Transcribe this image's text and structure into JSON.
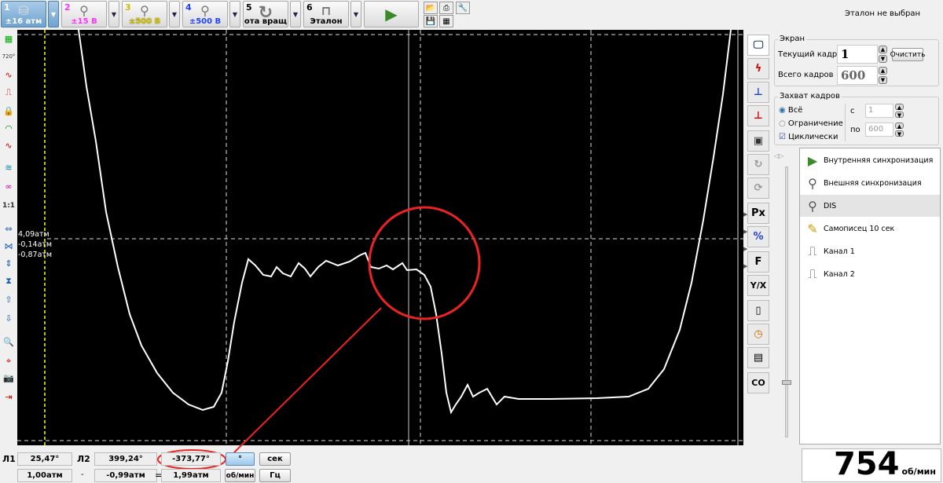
{
  "toolbar": {
    "channels": [
      {
        "num": "1",
        "label": "±16 атм",
        "color": "#ffffff",
        "icon": "pressure-sensor-icon"
      },
      {
        "num": "2",
        "label": "±15 В",
        "color": "#ff30ff",
        "icon": "probe-icon"
      },
      {
        "num": "3",
        "label": "±500 В",
        "color": "#e0d000",
        "icon": "probe-icon"
      },
      {
        "num": "4",
        "label": "±500 В",
        "color": "#2040ff",
        "icon": "probe-icon"
      },
      {
        "num": "5",
        "label": "ота вращ",
        "color": "#333333",
        "icon": "rotation-icon"
      },
      {
        "num": "6",
        "label": "Эталон",
        "color": "#333333",
        "icon": "caliper-icon"
      }
    ],
    "status": "Эталон не выбран"
  },
  "plot": {
    "cursor_labels": [
      "4,09атм",
      "-0,14атм",
      "-0,87атм"
    ]
  },
  "screen": {
    "title": "Экран",
    "current_frame_label": "Текущий кадр",
    "current_frame": "1",
    "clear": "Очистить",
    "total_frames_label": "Всего кадров",
    "total_frames": "600"
  },
  "capture": {
    "title": "Захват кадров",
    "all": "Всё",
    "limit": "Ограничение",
    "cyclic": "Циклически",
    "from_label": "с",
    "from": "1",
    "to_label": "по",
    "to": "600"
  },
  "sync_list": [
    "Внутренняя синхронизация",
    "Внешняя синхронизация",
    "DIS",
    "Самописец 10 сек",
    "Канал 1",
    "Канал 2"
  ],
  "right_tabs": [
    "Px",
    "F",
    "Y/X",
    "CO"
  ],
  "left_tools": [
    "720°",
    "1:1"
  ],
  "measure": {
    "l1_label": "Л1",
    "l1": "25,47°",
    "l2_label": "Л2",
    "l2": "399,24°",
    "diff": "-373,77°",
    "v1": "1,00атм",
    "minus": "-",
    "v2": "-0,99атм",
    "eq": "=",
    "vdiff": "1,99атм",
    "units": [
      "°",
      "сек",
      "об/мин",
      "Гц"
    ]
  },
  "rpm": {
    "value": "754",
    "unit": "об/мин"
  }
}
